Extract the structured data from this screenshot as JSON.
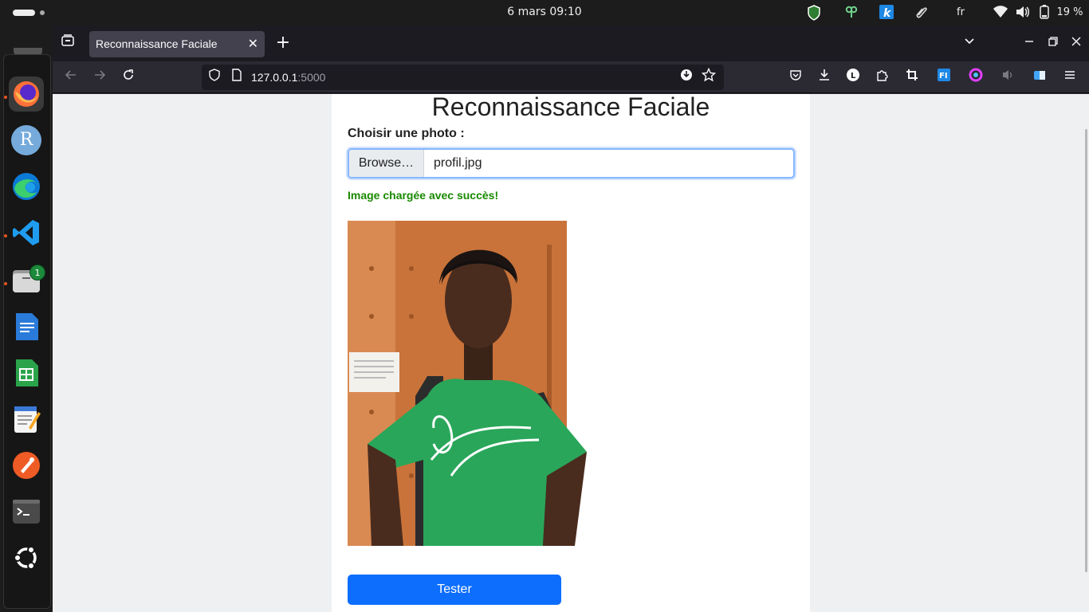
{
  "system": {
    "clock": "6 mars  09:10",
    "language": "fr",
    "battery": "19 %"
  },
  "dock": {
    "items": [
      {
        "name": "firefox",
        "letter": ""
      },
      {
        "name": "r-studio",
        "letter": "R"
      },
      {
        "name": "edge",
        "letter": ""
      },
      {
        "name": "vscode",
        "letter": ""
      },
      {
        "name": "files",
        "letter": ""
      },
      {
        "name": "writer",
        "letter": ""
      },
      {
        "name": "calc",
        "letter": ""
      },
      {
        "name": "text-editor",
        "letter": ""
      },
      {
        "name": "postman",
        "letter": ""
      },
      {
        "name": "terminal",
        "letter": ""
      },
      {
        "name": "ubuntu",
        "letter": ""
      }
    ],
    "files_badge": "1"
  },
  "browser": {
    "tab_title": "Reconnaissance Faciale",
    "url_host": "127.0.0.1",
    "url_port": ":5000"
  },
  "page": {
    "title": "Reconnaissance Faciale",
    "label": "Choisir une photo :",
    "browse_label": "Browse…",
    "file_name": "profil.jpg",
    "success_message": "Image chargée avec succès!",
    "submit_label": "Tester"
  },
  "colors": {
    "primary": "#0d6efd",
    "success": "#198a00"
  }
}
